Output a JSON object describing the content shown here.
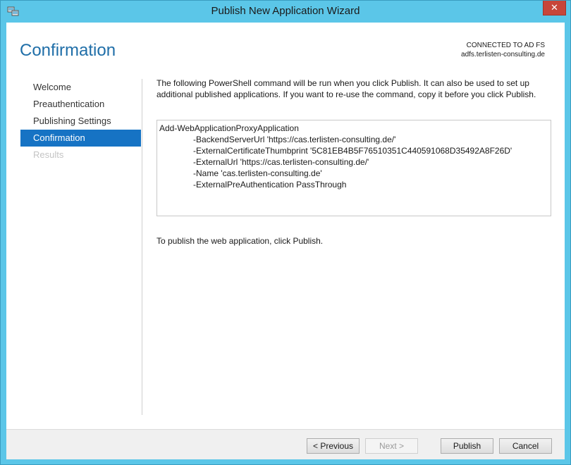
{
  "window": {
    "title": "Publish New Application Wizard",
    "close_glyph": "✕"
  },
  "header": {
    "page_title": "Confirmation",
    "connection_label": "CONNECTED TO AD FS",
    "connection_host": "adfs.terlisten-consulting.de"
  },
  "nav": {
    "items": [
      {
        "label": "Welcome",
        "state": "normal"
      },
      {
        "label": "Preauthentication",
        "state": "normal"
      },
      {
        "label": "Publishing Settings",
        "state": "normal"
      },
      {
        "label": "Confirmation",
        "state": "active"
      },
      {
        "label": "Results",
        "state": "disabled"
      }
    ]
  },
  "main": {
    "intro": "The following PowerShell command will be run when you click Publish. It can also be used to set up additional published applications. If you want to re-use the command, copy it before you click Publish.",
    "command": {
      "cmdlet": "Add-WebApplicationProxyApplication",
      "params": [
        "-BackendServerUrl 'https://cas.terlisten-consulting.de/'",
        "-ExternalCertificateThumbprint '5C81EB4B5F76510351C440591068D35492A8F26D'",
        "-ExternalUrl 'https://cas.terlisten-consulting.de/'",
        "-Name 'cas.terlisten-consulting.de'",
        "-ExternalPreAuthentication PassThrough"
      ]
    },
    "publish_hint": "To publish the web application, click Publish."
  },
  "footer": {
    "previous_label": "< Previous",
    "next_label": "Next >",
    "publish_label": "Publish",
    "cancel_label": "Cancel"
  },
  "colors": {
    "titlebar": "#5bc6e8",
    "accent": "#1673c4",
    "page_title": "#1f6ea8",
    "close": "#c7463a"
  },
  "icons": {
    "app": "wizard-app-icon",
    "close": "close-icon"
  }
}
